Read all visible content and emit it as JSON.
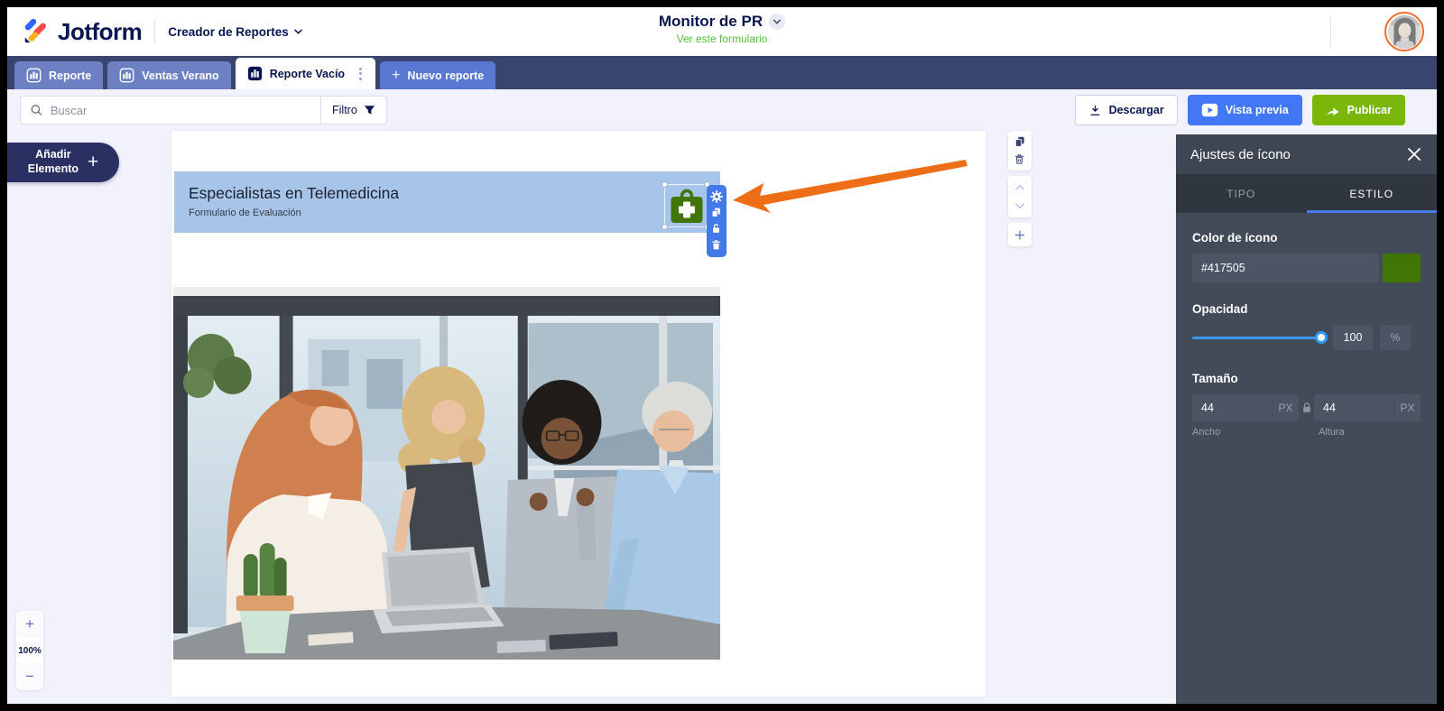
{
  "topbar": {
    "brand": "Jotform",
    "product": "Creador de Reportes",
    "form_title": "Monitor de PR",
    "form_link": "Ver este formulario"
  },
  "tabs": {
    "items": [
      {
        "label": "Reporte"
      },
      {
        "label": "Ventas Verano"
      },
      {
        "label": "Reporte Vacío"
      }
    ],
    "new_report": "Nuevo reporte",
    "new_plus": "+"
  },
  "toolbar": {
    "search_placeholder": "Buscar",
    "filter": "Filtro",
    "download": "Descargar",
    "preview": "Vista previa",
    "publish": "Publicar"
  },
  "sidebar": {
    "add_element_line1": "Añadir",
    "add_element_line2": "Elemento",
    "plus": "+"
  },
  "canvas": {
    "title": "Especialistas en Telemedicina",
    "subtitle": "Formulario de Evaluación"
  },
  "zoom_control": {
    "zoom_in": "+",
    "level": "100%",
    "zoom_out": "−"
  },
  "panel": {
    "title": "Ajustes de ícono",
    "tab_tipo": "TIPO",
    "tab_estilo": "ESTILO",
    "color_label": "Color de ícono",
    "color_value": "#417505",
    "opacity_label": "Opacidad",
    "opacity_value": "100",
    "opacity_unit": "%",
    "size_label": "Tamaño",
    "width_value": "44",
    "height_value": "44",
    "unit": "PX",
    "width_label": "Ancho",
    "height_label": "Altura"
  },
  "colors": {
    "brand_navy": "#0A1551",
    "accent_blue": "#4277F5",
    "publish_green": "#7BB60B",
    "icon_green": "#417505",
    "arrow_orange": "#ED6E17",
    "header_element_blue": "#A7C4E9"
  }
}
